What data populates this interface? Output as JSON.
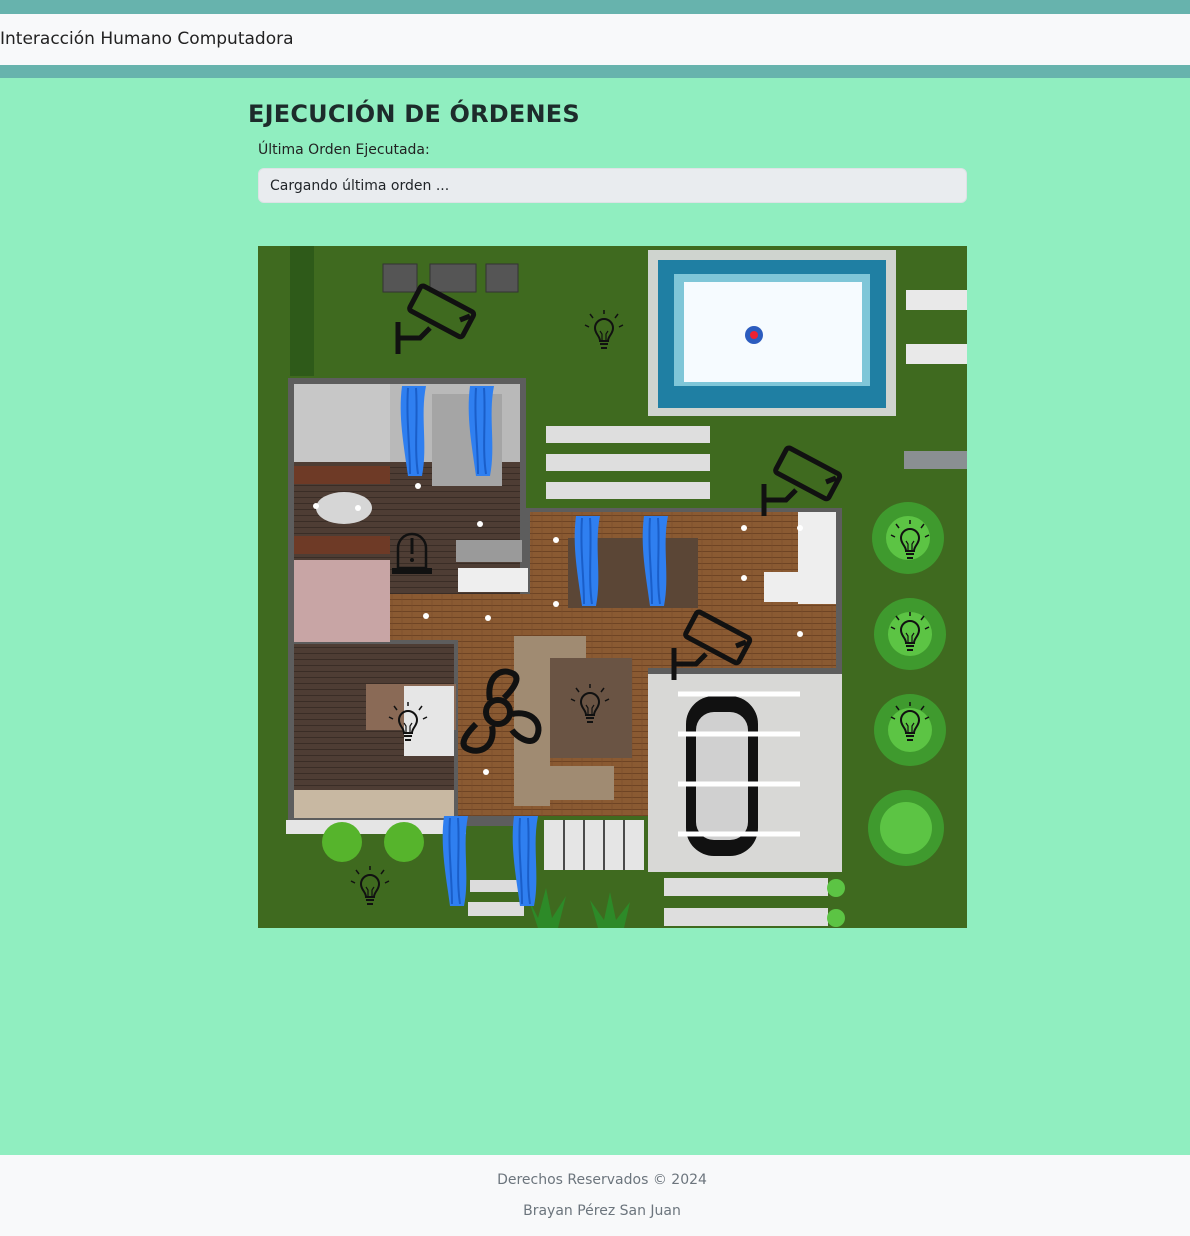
{
  "navbar": {
    "brand": "Interacción Humano Computadora"
  },
  "page": {
    "heading": "EJECUCIÓN DE ÓRDENES",
    "last_order_label": "Última Orden Ejecutada:",
    "last_order_value": "Cargando última orden ..."
  },
  "floorplan": {
    "icons": [
      "security-camera-icon",
      "light-bulb-icon",
      "ceiling-fan-icon",
      "alarm-siren-icon",
      "curtain-icon"
    ]
  },
  "footer": {
    "copyright": "Derechos Reservados © 2024",
    "author": "Brayan Pérez San Juan"
  },
  "colors": {
    "top_band": "#67b3ad",
    "page_background": "#90eec0",
    "navbar_background": "#f8f9fa",
    "curtain_blue": "#2f7ff0"
  }
}
